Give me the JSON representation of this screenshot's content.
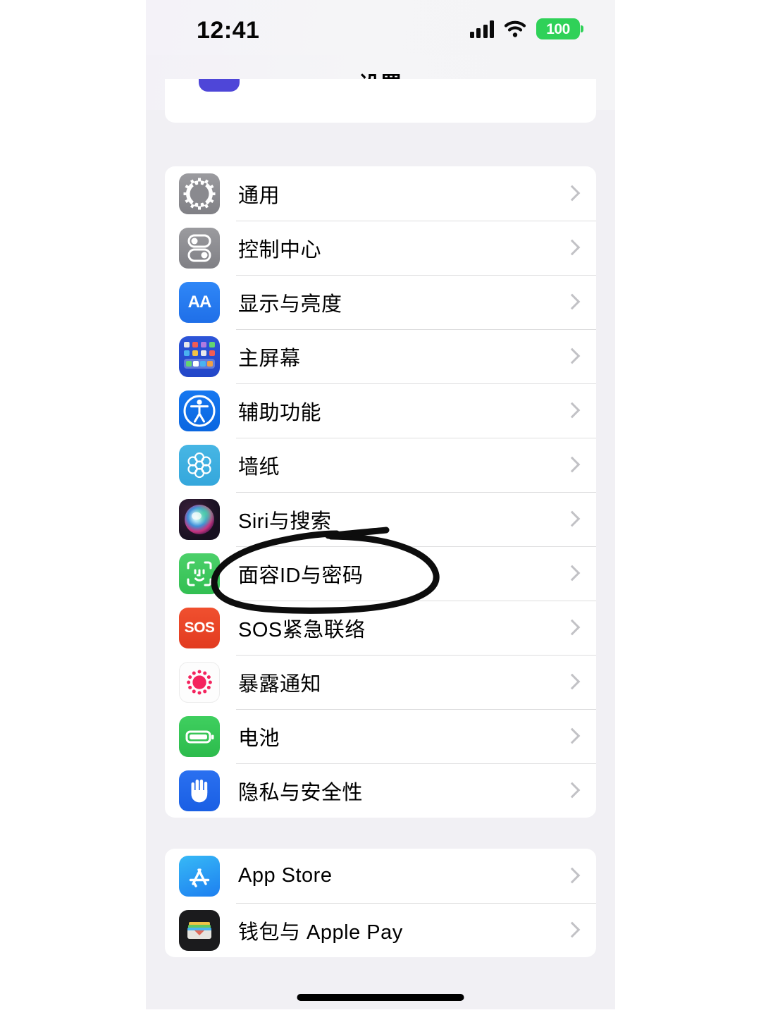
{
  "status_bar": {
    "time": "12:41",
    "signal_icon": "cellular-bars-icon",
    "wifi_icon": "wifi-icon",
    "battery_level": "100",
    "battery_color": "#2fd158"
  },
  "nav": {
    "title": "设置"
  },
  "sections": [
    {
      "id": "system",
      "clipped_top": true,
      "rows": [
        {
          "label": "通用",
          "icon": "gear-icon",
          "icon_color": "#8a8a8f"
        },
        {
          "label": "控制中心",
          "icon": "control-center-icon",
          "icon_color": "#8a8a8f"
        },
        {
          "label": "显示与亮度",
          "icon": "display-brightness-icon",
          "icon_color": "#2f87f7",
          "glyph": "AA"
        },
        {
          "label": "主屏幕",
          "icon": "home-screen-icon",
          "icon_color": "#2d55d8"
        },
        {
          "label": "辅助功能",
          "icon": "accessibility-icon",
          "icon_color": "#1778f0"
        },
        {
          "label": "墙纸",
          "icon": "wallpaper-icon",
          "icon_color": "#47b6e4"
        },
        {
          "label": "Siri与搜索",
          "icon": "siri-icon",
          "icon_color": "#171020"
        },
        {
          "label": "面容ID与密码",
          "icon": "face-id-icon",
          "icon_color": "#4cd06a"
        },
        {
          "label": "SOS紧急联络",
          "icon": "sos-icon",
          "icon_color": "#f0502f",
          "glyph": "SOS"
        },
        {
          "label": "暴露通知",
          "icon": "exposure-notification-icon",
          "icon_color": "#f4245e"
        },
        {
          "label": "电池",
          "icon": "battery-icon",
          "icon_color": "#3fcf5f"
        },
        {
          "label": "隐私与安全性",
          "icon": "privacy-hand-icon",
          "icon_color": "#2a70f0"
        }
      ]
    },
    {
      "id": "store",
      "clipped_top": false,
      "rows": [
        {
          "label": "App Store",
          "icon": "app-store-icon",
          "icon_color": "#1d7ff0"
        },
        {
          "label": "钱包与 Apple Pay",
          "icon": "wallet-icon",
          "icon_color": "#1b1b1d"
        }
      ]
    }
  ],
  "annotation": {
    "type": "hand-drawn-ellipse",
    "color": "#0d0d0d",
    "targets_row_label": "面容ID与密码"
  },
  "home_indicator": {
    "visible": true
  }
}
